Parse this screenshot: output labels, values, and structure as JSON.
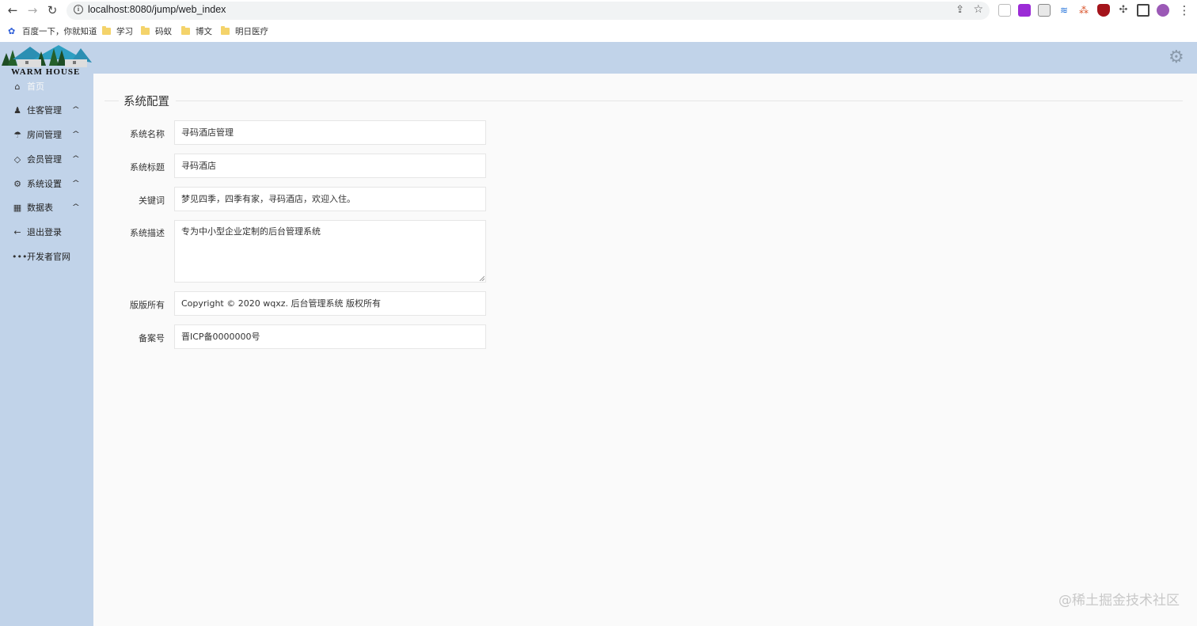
{
  "browser": {
    "url": "localhost:8080/jump/web_index",
    "bookmarks": [
      {
        "label": "百度一下，你就知道",
        "type": "site"
      },
      {
        "label": "学习",
        "type": "folder"
      },
      {
        "label": "码蚁",
        "type": "folder"
      },
      {
        "label": "博文",
        "type": "folder"
      },
      {
        "label": "明日医疗",
        "type": "folder"
      }
    ]
  },
  "logo": {
    "text": "WARM HOUSE"
  },
  "sidebar": {
    "items": [
      {
        "label": "首页",
        "icon": "home-icon"
      },
      {
        "label": "住客管理",
        "icon": "user-icon"
      },
      {
        "label": "房间管理",
        "icon": "tree-icon"
      },
      {
        "label": "会员管理",
        "icon": "diamond-icon"
      },
      {
        "label": "系统设置",
        "icon": "gear-icon"
      },
      {
        "label": "数据表",
        "icon": "table-icon"
      },
      {
        "label": "退出登录",
        "icon": "arrow-left-icon"
      },
      {
        "label": "开发者官网",
        "icon": "more-icon"
      }
    ]
  },
  "main": {
    "section_title": "系统配置",
    "fields": [
      {
        "label": "系统名称",
        "value": "寻码酒店管理"
      },
      {
        "label": "系统标题",
        "value": "寻码酒店"
      },
      {
        "label": "关键词",
        "value": "梦见四季，四季有家，寻码酒店，欢迎入住。"
      },
      {
        "label": "系统描述",
        "value": "专为中小型企业定制的后台管理系统"
      },
      {
        "label": "版版所有",
        "value": "Copyright © 2020  wqxz. 后台管理系统 版权所有"
      },
      {
        "label": "备案号",
        "value": "晋ICP备0000000号"
      }
    ]
  },
  "watermark": "@稀土掘金技术社区"
}
